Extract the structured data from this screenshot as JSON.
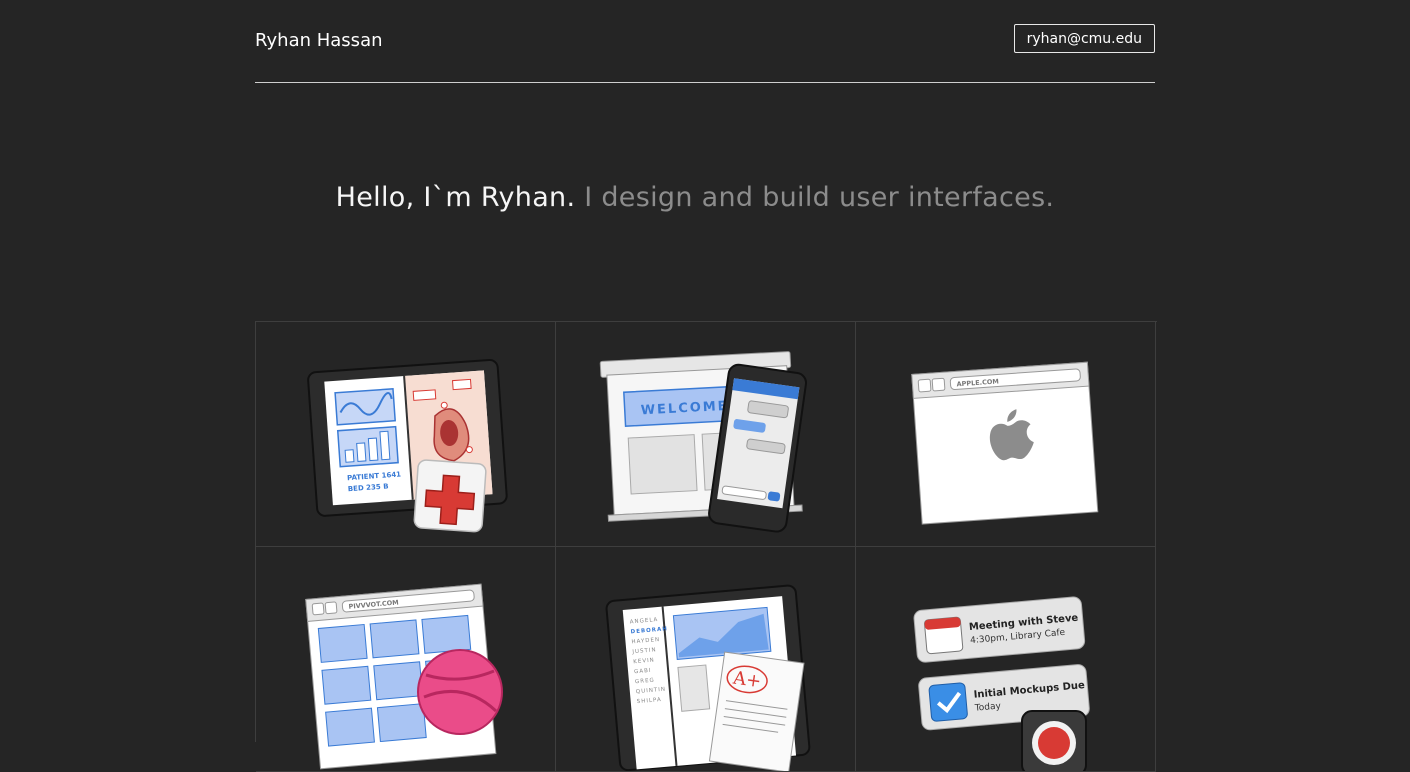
{
  "header": {
    "name": "Ryhan Hassan",
    "email": "ryhan@cmu.edu"
  },
  "hero": {
    "greeting": "Hello, I`m Ryhan.",
    "tagline": " I design and build user interfaces."
  },
  "projects": [
    {
      "icon": "medical-tablet-icon",
      "lines": [
        "PATIENT 1641",
        "BED 235 B"
      ]
    },
    {
      "icon": "welcome-presentation-icon",
      "banner": "WELCOME"
    },
    {
      "icon": "browser-apple-icon",
      "url": "APPLE.COM"
    },
    {
      "icon": "pivvvot-dribbble-icon",
      "url": "PIVVVOT.COM"
    },
    {
      "icon": "grades-tablet-icon",
      "names": [
        "ANGELA",
        "DEBORAH",
        "HAYDEN",
        "JUSTIN",
        "KEVIN",
        "GABI",
        "GREG",
        "QUINTIN",
        "SHILPA"
      ],
      "grade": "A+"
    },
    {
      "icon": "reminders-icon",
      "items": [
        {
          "title": "Meeting with Steve",
          "subtitle": "4:30pm, Library Cafe"
        },
        {
          "title": "Initial Mockups Due",
          "subtitle": "Today"
        }
      ]
    }
  ],
  "colors": {
    "background": "#252525",
    "accent_blue": "#3a7bd5",
    "accent_red": "#d83a34"
  }
}
